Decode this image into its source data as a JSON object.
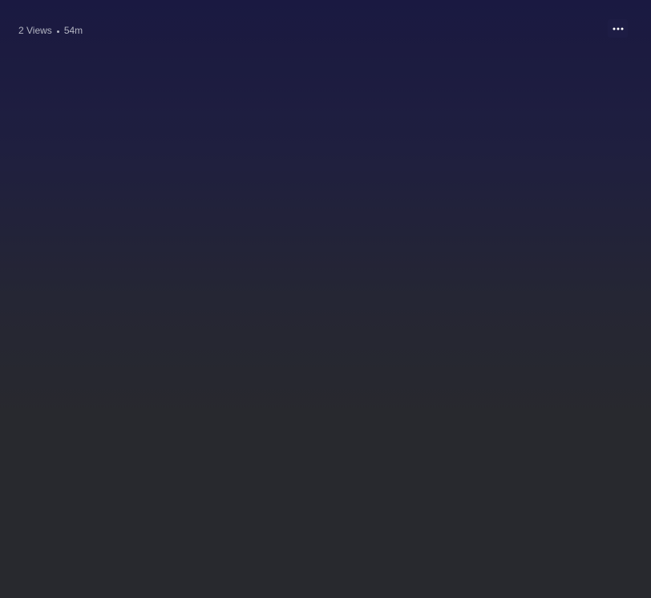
{
  "post_meta": {
    "views": "2 Views",
    "separator": "•",
    "time_ago": "54m"
  },
  "icons": {
    "more": "more-horizontal-icon"
  },
  "colors": {
    "gradient_top": "#1a1941",
    "gradient_bottom": "#28292e",
    "meta_text": "#b3b5c2",
    "icon": "#ffffff"
  }
}
